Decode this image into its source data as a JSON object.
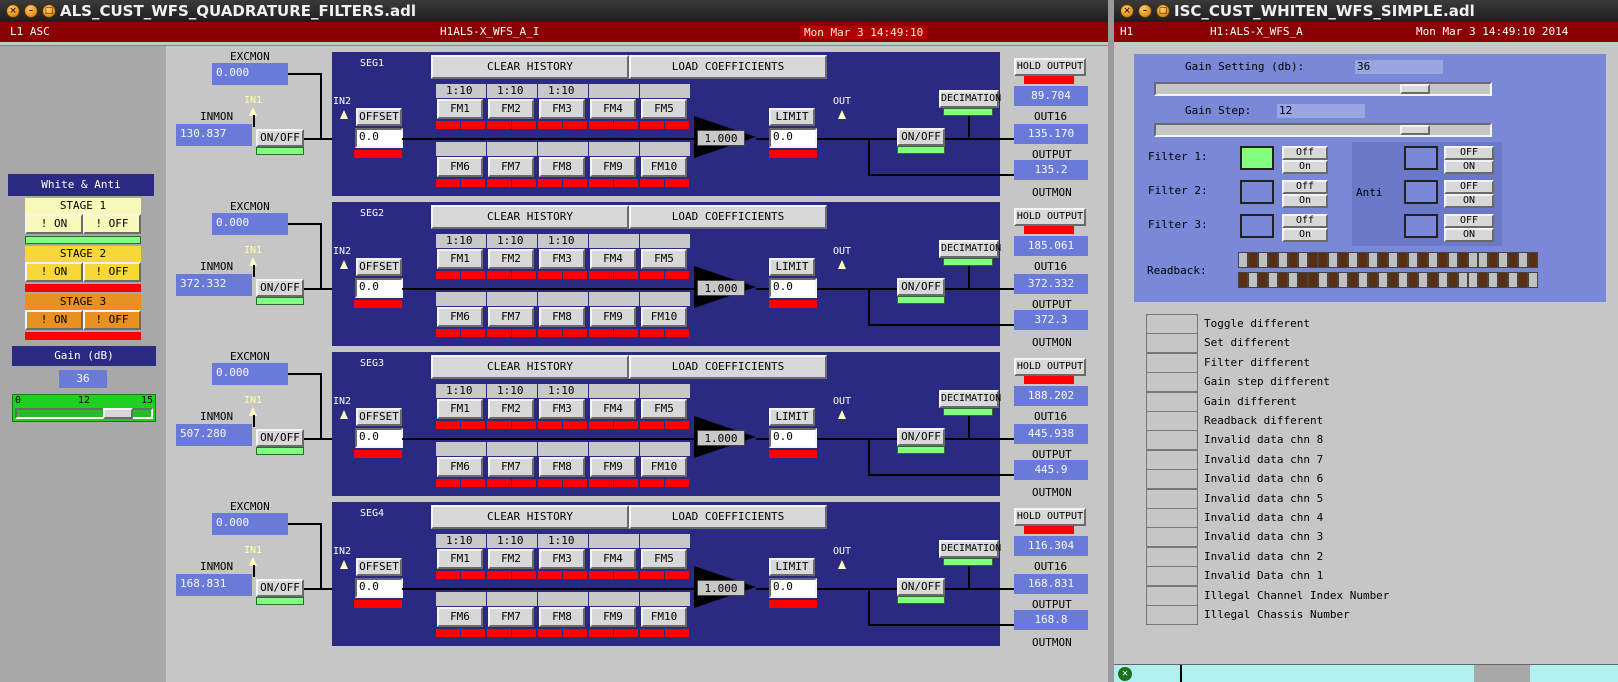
{
  "left_window": {
    "title": "ALS_CUST_WFS_QUADRATURE_FILTERS.adl",
    "header": {
      "site": "L1 ASC",
      "channel": "H1ALS-X_WFS_A_I",
      "datetime": "Mon Mar  3 14:49:10"
    },
    "sidebar": {
      "white_anti": "White &  Anti",
      "stage1": "STAGE 1",
      "stage2": "STAGE 2",
      "stage3": "STAGE 3",
      "on_label": "! ON",
      "off_label": "! OFF",
      "gain_label": "Gain (dB)",
      "gain_value": "36",
      "slider_min": "0",
      "slider_mid": "12",
      "slider_max": "15"
    },
    "common": {
      "excmon": "EXCMON",
      "inmon": "INMON",
      "in1": "IN1",
      "in2": "IN2",
      "onoff": "ON/OFF",
      "offset": "OFFSET",
      "offset_value": "0.0",
      "clear_history": "CLEAR HISTORY",
      "load_coefficients": "LOAD COEFFICIENTS",
      "ratio": "1:10",
      "fm": [
        "FM1",
        "FM2",
        "FM3",
        "FM4",
        "FM5",
        "FM6",
        "FM7",
        "FM8",
        "FM9",
        "FM10"
      ],
      "gain_value": "1.000",
      "limit": "LIMIT",
      "limit_value": "0.0",
      "out": "OUT",
      "hold_output": "HOLD OUTPUT",
      "decimation": "DECIMATION",
      "out16": "OUT16",
      "output": "OUTPUT",
      "outmon": "OUTMON"
    },
    "segments": [
      {
        "name": "SEG1",
        "excmon": "0.000",
        "inmon": "130.837",
        "top_value": "89.704",
        "out16": "135.170",
        "output": "135.2"
      },
      {
        "name": "SEG2",
        "excmon": "0.000",
        "inmon": "372.332",
        "top_value": "185.061",
        "out16": "372.332",
        "output": "372.3"
      },
      {
        "name": "SEG3",
        "excmon": "0.000",
        "inmon": "507.280",
        "top_value": "188.202",
        "out16": "445.938",
        "output": "445.9"
      },
      {
        "name": "SEG4",
        "excmon": "0.000",
        "inmon": "168.831",
        "top_value": "116.304",
        "out16": "168.831",
        "output": "168.8"
      }
    ]
  },
  "right_window": {
    "title": "ISC_CUST_WHITEN_WFS_SIMPLE.adl",
    "header": {
      "site": "H1",
      "channel": "H1:ALS-X_WFS_A",
      "datetime": "Mon Mar  3 14:49:10 2014"
    },
    "gain_setting_label": "Gain Setting (db):",
    "gain_setting_value": "36",
    "gain_step_label": "Gain Step:",
    "gain_step_value": "12",
    "filters": [
      {
        "label": "Filter 1:",
        "active": true
      },
      {
        "label": "Filter 2:",
        "active": false
      },
      {
        "label": "Filter 3:",
        "active": false
      }
    ],
    "anti_label": "Anti",
    "off_label": "Off",
    "on_label": "On",
    "anti_off_label": "OFF",
    "anti_on_label": "ON",
    "readback_label": "Readback:",
    "status_items": [
      "Toggle different",
      "Set different",
      "Filter different",
      "Gain step different",
      "Gain different",
      "Readback different",
      "Invalid data chn 8",
      "Invalid data chn 7",
      "Invalid data chn 6",
      "Invalid data chn 5",
      "Invalid data chn 4",
      "Invalid data chn 3",
      "Invalid data chn 2",
      "Invalid Data chn 1",
      "Illegal Channel Index Number",
      "Illegal Chassis Number"
    ]
  },
  "colors": {
    "panel_blue": "#2a2a82",
    "value_blue": "#6a7ad8",
    "alarm_red": "#ff0000",
    "ok_green": "#80ff80",
    "header_red": "#8b0000"
  }
}
